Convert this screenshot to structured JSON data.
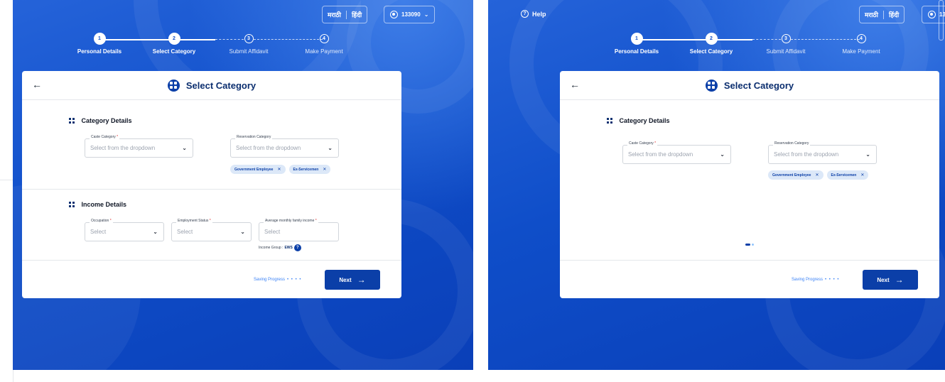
{
  "help": {
    "label": "Help"
  },
  "language": {
    "marathi": "मराठी",
    "hindi": "हिंदी"
  },
  "user": {
    "id": "133090",
    "id_partial": "13"
  },
  "steps": [
    {
      "num": "1",
      "label": "Personal Details"
    },
    {
      "num": "2",
      "label": "Select Category"
    },
    {
      "num": "3",
      "label": "Submit Affidavit"
    },
    {
      "num": "4",
      "label": "Make Payment"
    }
  ],
  "card": {
    "title": "Select Category"
  },
  "category_section": {
    "title": "Category Details",
    "caste": {
      "label": "Caste Category",
      "placeholder": "Select from the dropdown"
    },
    "reservation": {
      "label": "Reservation Category",
      "placeholder": "Select from the dropdown"
    },
    "chips": [
      "Government Employee",
      "Ex-Servicemen"
    ]
  },
  "income_section": {
    "title": "Income Details",
    "occupation": {
      "label": "Occupation",
      "placeholder": "Select"
    },
    "employment": {
      "label": "Employment Status",
      "placeholder": "Select"
    },
    "income": {
      "label": "Average monthly family income",
      "placeholder": "Select"
    },
    "group_label": "Income Group :",
    "group_value": "EWS"
  },
  "footer": {
    "saving": "Saving Progress",
    "next": "Next"
  },
  "symbols": {
    "required": "*",
    "chip_close": "✕",
    "back": "←",
    "chevron": "⌄",
    "next_arrow": "→",
    "info": "?",
    "help_q": "?",
    "dots": "• • • •"
  }
}
